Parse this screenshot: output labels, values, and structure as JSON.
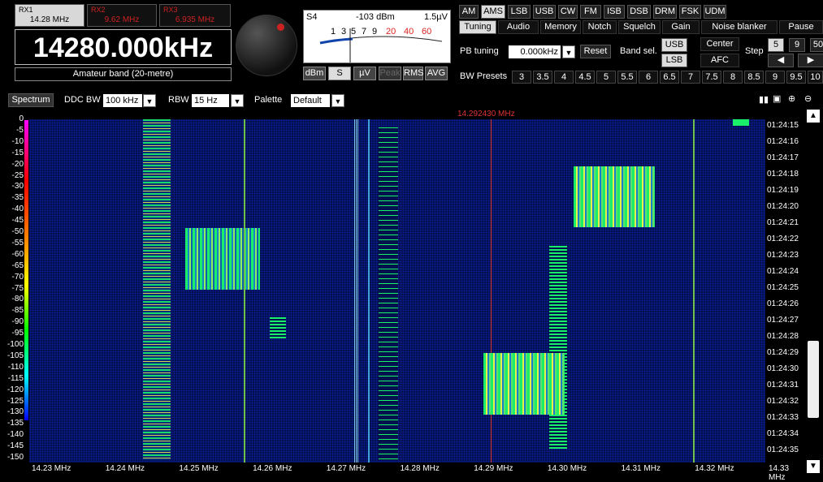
{
  "receivers": [
    {
      "name": "RX1",
      "freq": "14.28 MHz",
      "active": true
    },
    {
      "name": "RX2",
      "freq": "9.62 MHz",
      "active": false
    },
    {
      "name": "RX3",
      "freq": "6.935 MHz",
      "active": false
    }
  ],
  "main_freq": "14280.000kHz",
  "band": "Amateur band (20-metre)",
  "meter": {
    "s_label": "S4",
    "dbm": "-103 dBm",
    "uv": "1.5µV",
    "scale": [
      "1",
      "3",
      "5",
      "7",
      "9",
      "20",
      "40",
      "60"
    ],
    "units": [
      "dBm",
      "S",
      "µV",
      "Peak",
      "RMS",
      "AVG"
    ]
  },
  "modes": [
    "AM",
    "AMS",
    "LSB",
    "USB",
    "CW",
    "FM",
    "ISB",
    "DSB",
    "DRM",
    "FSK",
    "UDM"
  ],
  "active_mode": "AMS",
  "tabs": [
    "Tuning",
    "Audio",
    "Memory",
    "Notch",
    "Squelch",
    "Gain",
    "Noise blanker",
    "Pause"
  ],
  "active_tab": "Tuning",
  "pb_tuning": {
    "label": "PB tuning",
    "value": "0.000kHz",
    "reset": "Reset"
  },
  "band_sel": {
    "label": "Band sel.",
    "usb": "USB",
    "lsb": "LSB"
  },
  "center": "Center",
  "afc": "AFC",
  "step": {
    "label": "Step",
    "values": [
      "5",
      "9",
      "50"
    ]
  },
  "bw_presets": {
    "label": "BW Presets",
    "values": [
      "3",
      "3.5",
      "4",
      "4.5",
      "5",
      "5.5",
      "6",
      "6.5",
      "7",
      "7.5",
      "8",
      "8.5",
      "9",
      "9.5",
      "10"
    ]
  },
  "spectrum": {
    "tab": "Spectrum",
    "ddc_label": "DDC BW",
    "ddc_value": "100 kHz",
    "rbw_label": "RBW",
    "rbw_value": "15 Hz",
    "palette_label": "Palette",
    "palette_value": "Default",
    "marker": "14.292430 MHz"
  },
  "db_scale": [
    "0",
    "-5",
    "-10",
    "-15",
    "-20",
    "-25",
    "-30",
    "-35",
    "-40",
    "-45",
    "-50",
    "-55",
    "-60",
    "-65",
    "-70",
    "-75",
    "-80",
    "-85",
    "-90",
    "-95",
    "-100",
    "-105",
    "-110",
    "-115",
    "-120",
    "-125",
    "-130",
    "-135",
    "-140",
    "-145",
    "-150"
  ],
  "times": [
    "01:24:15",
    "01:24:16",
    "01:24:17",
    "01:24:18",
    "01:24:19",
    "01:24:20",
    "01:24:21",
    "01:24:22",
    "01:24:23",
    "01:24:24",
    "01:24:25",
    "01:24:26",
    "01:24:27",
    "01:24:28",
    "01:24:29",
    "01:24:30",
    "01:24:31",
    "01:24:32",
    "01:24:33",
    "01:24:34",
    "01:24:35"
  ],
  "freq_axis": [
    "14.23 MHz",
    "14.24 MHz",
    "14.25 MHz",
    "14.26 MHz",
    "14.27 MHz",
    "14.28 MHz",
    "14.29 MHz",
    "14.30 MHz",
    "14.31 MHz",
    "14.32 MHz",
    "14.33 MHz"
  ],
  "colors": {
    "accent_red": "#dd3333",
    "waterfall_bg": "#03124c"
  }
}
